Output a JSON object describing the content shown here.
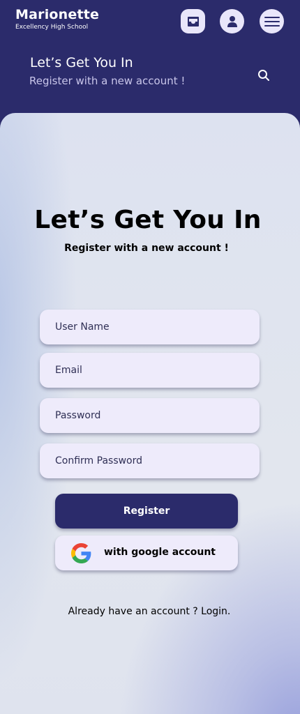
{
  "brand": {
    "name": "Marionette",
    "subtitle": "Excellency High School"
  },
  "header": {
    "title": "Let’s Get You In",
    "subtitle": "Register with a new account !",
    "icons": [
      "inbox-icon",
      "user-icon",
      "menu-icon",
      "search-icon"
    ]
  },
  "form": {
    "title": "Let’s Get You In",
    "subtitle": "Register with a new account !",
    "fields": {
      "username_placeholder": "User Name",
      "email_placeholder": "Email",
      "password_placeholder": "Password",
      "confirm_placeholder": "Confirm Password"
    },
    "register_label": "Register",
    "google_label": "with google account",
    "login_text": "Already have an account ? Login."
  },
  "colors": {
    "primary": "#2b2b6b",
    "field_bg": "#eeebfb",
    "card_bg": "#e0e4ef"
  }
}
